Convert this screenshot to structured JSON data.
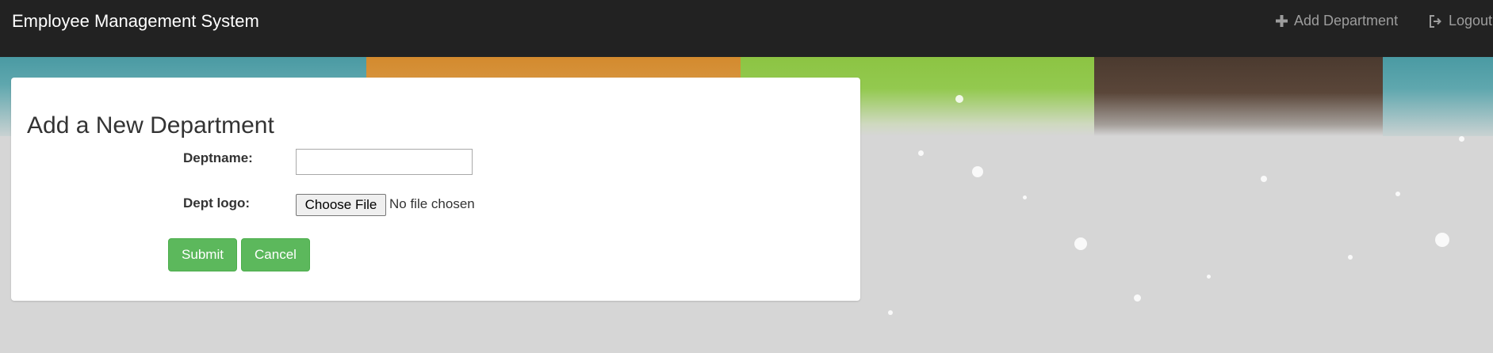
{
  "navbar": {
    "brand": "Employee Management System",
    "add_department": "Add Department",
    "logout": "Logout"
  },
  "form": {
    "title": "Add a New Department",
    "deptname_label": "Deptname:",
    "deptname_value": "",
    "logo_label": "Dept logo:",
    "choose_file": "Choose File",
    "file_status": "No file chosen",
    "submit": "Submit",
    "cancel": "Cancel"
  },
  "colors": {
    "navbar_bg": "#222222",
    "button_green": "#5cb85c"
  },
  "icons": [
    "plus-icon",
    "logout-icon"
  ]
}
